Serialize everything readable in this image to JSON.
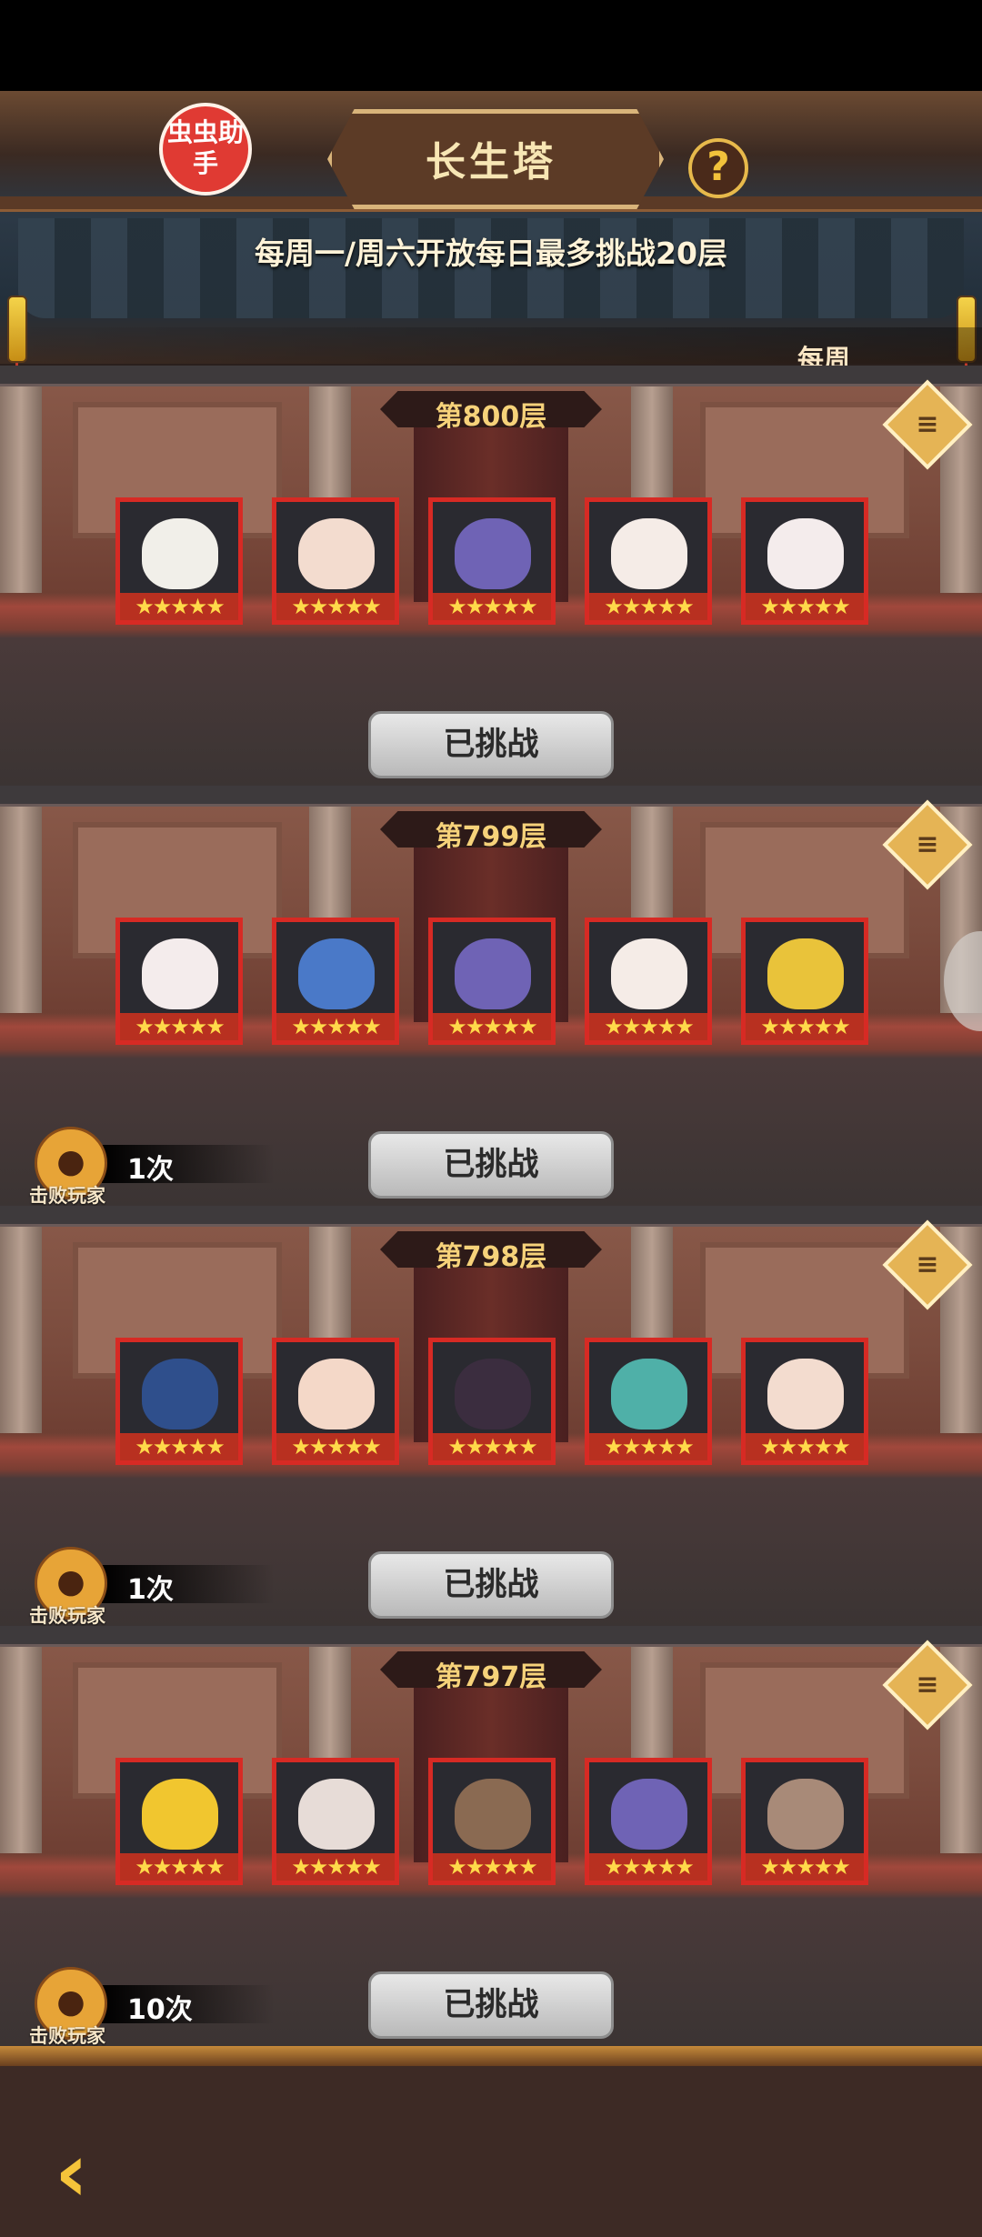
{
  "header": {
    "logo_text": "虫虫助手",
    "title": "长生塔",
    "help_icon": "?",
    "subtitle": "每周一/周六开放每日最多挑战20层",
    "period_label": "每周"
  },
  "floors": [
    {
      "label": "第800层",
      "avatars": [
        "#f1efe9",
        "#f3dccf",
        "#6f63b5",
        "#f5ece7",
        "#f4ecec"
      ],
      "stars": "★★★★★",
      "button": "已挑战",
      "defeat": null
    },
    {
      "label": "第799层",
      "avatars": [
        "#f4ecec",
        "#4a79c8",
        "#6f63b5",
        "#f5ece7",
        "#e9c33a"
      ],
      "stars": "★★★★★",
      "button": "已挑战",
      "defeat": {
        "count": "1次",
        "label": "击败玩家"
      }
    },
    {
      "label": "第798层",
      "avatars": [
        "#2f4f8c",
        "#f4d8c8",
        "#3b2d3f",
        "#4fb0a8",
        "#f3dccf"
      ],
      "stars": "★★★★★",
      "button": "已挑战",
      "defeat": {
        "count": "1次",
        "label": "击败玩家"
      }
    },
    {
      "label": "第797层",
      "avatars": [
        "#f1c62f",
        "#e7dcd7",
        "#8a6a52",
        "#6f63b5",
        "#a88a78"
      ],
      "stars": "★★★★★",
      "button": "已挑战",
      "defeat": {
        "count": "10次",
        "label": "击败玩家"
      }
    }
  ],
  "footer": {
    "back_icon": "‹"
  }
}
